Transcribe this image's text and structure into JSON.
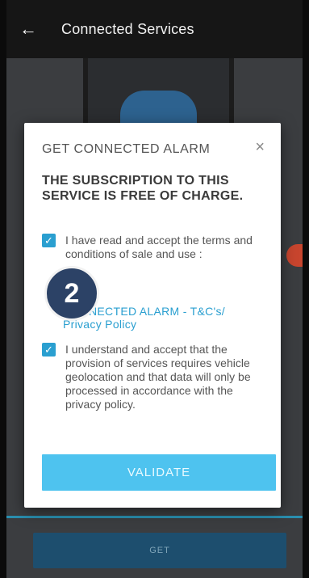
{
  "header": {
    "title": "Connected Services",
    "back_icon": "←"
  },
  "modal": {
    "title": "GET CONNECTED ALARM",
    "close_icon": "×",
    "free_text": "THE SUBSCRIPTION TO THIS SERVICE IS FREE OF CHARGE.",
    "terms_label": "I have read and accept the terms and conditions of sale and use :",
    "terms_link": "CONNECTED ALARM - T&C's/ Privacy Policy",
    "geo_label": "I understand and accept that the provision of services requires vehicle geolocation and that data will only be processed in accordance with the privacy policy.",
    "validate_label": "VALIDATE",
    "terms_checked": true,
    "geo_checked": true
  },
  "bottom": {
    "get_label": "GET"
  },
  "overlay": {
    "step_number": "2"
  },
  "colors": {
    "accent": "#2a9fd0",
    "validate": "#4ec3ef",
    "step_badge": "#2c4266"
  }
}
